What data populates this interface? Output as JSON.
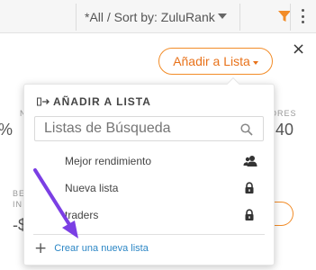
{
  "toolbar": {
    "sort_label": "*All / Sort by: ZuluRank",
    "icons": [
      "chevron-down-icon",
      "filter-icon",
      "kebab-menu-icon"
    ],
    "filter_color": "#f28c28"
  },
  "background": {
    "pct_fragment": "%",
    "n_fragment": "N",
    "stat_label_fragment": "ORES",
    "stat_value_fragment": "40",
    "left_label_fragment_1": "BE",
    "left_label_fragment_2": "IN",
    "left_value_fragment": "-$"
  },
  "close_symbol": "×",
  "add_to_list_button": {
    "label": "Añadir a Lista",
    "accent": "#f28c28"
  },
  "dropdown": {
    "header": "AÑADIR A LISTA",
    "search_placeholder": "Listas de Búsqueda",
    "items": [
      {
        "label": "Mejor rendimiento",
        "icon": "users-icon"
      },
      {
        "label": "Nueva lista",
        "icon": "lock-icon"
      },
      {
        "label": "traders",
        "icon": "lock-icon"
      }
    ],
    "create_label": "Crear una nueva lista",
    "link_color": "#2b86c5"
  },
  "annotation": {
    "arrow_color": "#7b3fe4"
  }
}
